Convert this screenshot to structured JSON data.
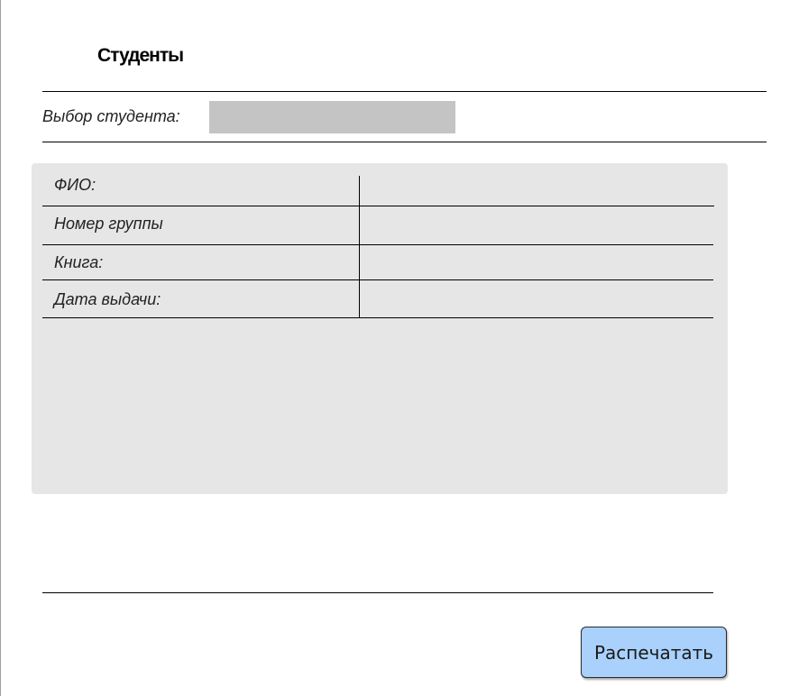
{
  "header": {
    "title": "Студенты"
  },
  "student_select": {
    "label": "Выбор студента:",
    "value": ""
  },
  "details": {
    "rows": [
      {
        "label": "ФИО:",
        "value": ""
      },
      {
        "label": "Номер группы",
        "value": ""
      },
      {
        "label": "Книга:",
        "value": ""
      },
      {
        "label": "Дата выдачи:",
        "value": ""
      }
    ]
  },
  "actions": {
    "print_label": "Распечатать"
  },
  "colors": {
    "panel": "#e6e6e6",
    "select_box": "#c4c4c4",
    "button": "#a9d1fb"
  }
}
